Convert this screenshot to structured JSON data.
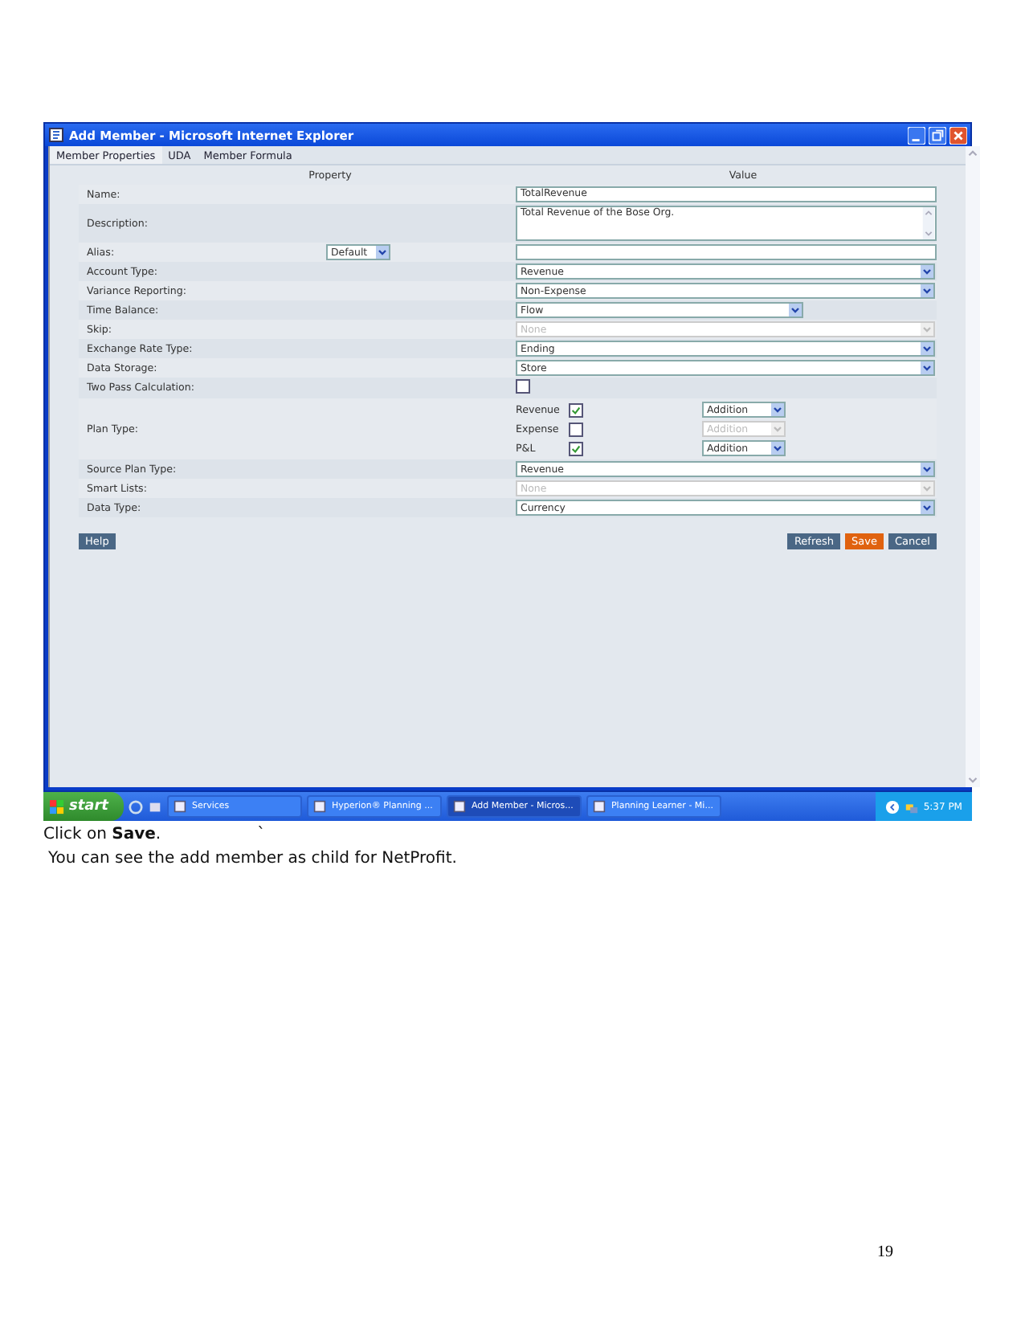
{
  "window": {
    "title": "Add Member - Microsoft Internet Explorer"
  },
  "tabs": [
    {
      "label": "Member Properties",
      "selected": true
    },
    {
      "label": "UDA",
      "selected": false
    },
    {
      "label": "Member Formula",
      "selected": false
    }
  ],
  "table": {
    "columns": [
      "Property",
      "Value"
    ],
    "rows": [
      {
        "label": "Name:",
        "kind": "text",
        "value": "TotalRevenue"
      },
      {
        "label": "Description:",
        "kind": "textarea",
        "value": "Total Revenue of the Bose Org."
      },
      {
        "label": "Alias:",
        "kind": "alias",
        "alias_select": "Default"
      },
      {
        "label": "Account Type:",
        "kind": "select",
        "value": "Revenue",
        "disabled": false,
        "short": false
      },
      {
        "label": "Variance Reporting:",
        "kind": "select",
        "value": "Non-Expense",
        "disabled": false,
        "short": false
      },
      {
        "label": "Time Balance:",
        "kind": "select",
        "value": "Flow",
        "disabled": false,
        "short": true
      },
      {
        "label": "Skip:",
        "kind": "select",
        "value": "None",
        "disabled": true,
        "short": false
      },
      {
        "label": "Exchange Rate Type:",
        "kind": "select",
        "value": "Ending",
        "disabled": false,
        "short": false
      },
      {
        "label": "Data Storage:",
        "kind": "select",
        "value": "Store",
        "disabled": false,
        "short": false
      },
      {
        "label": "Two Pass Calculation:",
        "kind": "checkbox",
        "checked": false
      },
      {
        "label": "Plan Type:",
        "kind": "plans",
        "plans": [
          {
            "name": "Revenue",
            "checked": true,
            "consolidation": "Addition",
            "disabled": false
          },
          {
            "name": "Expense",
            "checked": false,
            "consolidation": "Addition",
            "disabled": true
          },
          {
            "name": "P&L",
            "checked": true,
            "consolidation": "Addition",
            "disabled": false
          }
        ]
      },
      {
        "label": "Source Plan Type:",
        "kind": "select",
        "value": "Revenue",
        "disabled": false,
        "short": false
      },
      {
        "label": "Smart Lists:",
        "kind": "select",
        "value": "None",
        "disabled": true,
        "short": false
      },
      {
        "label": "Data Type:",
        "kind": "select",
        "value": "Currency",
        "disabled": false,
        "short": false
      }
    ]
  },
  "buttons_left": [
    "Help"
  ],
  "buttons_right": [
    {
      "label": "Refresh",
      "kind": "normal"
    },
    {
      "label": "Save",
      "kind": "primary"
    },
    {
      "label": "Cancel",
      "kind": "normal"
    }
  ],
  "taskbar": {
    "start": "start",
    "items": [
      {
        "label": "Services",
        "selected": false
      },
      {
        "label": "Hyperion® Planning ...",
        "selected": false
      },
      {
        "label": "Add Member - Micros...",
        "selected": true
      },
      {
        "label": "Planning Learner - Mi...",
        "selected": false
      }
    ],
    "clock": "5:37 PM"
  },
  "document": {
    "instruction": "Click on **Save**.",
    "stray_mark": "`",
    "note": "You can see the add member as child for NetProfit.",
    "page_number": "19"
  }
}
